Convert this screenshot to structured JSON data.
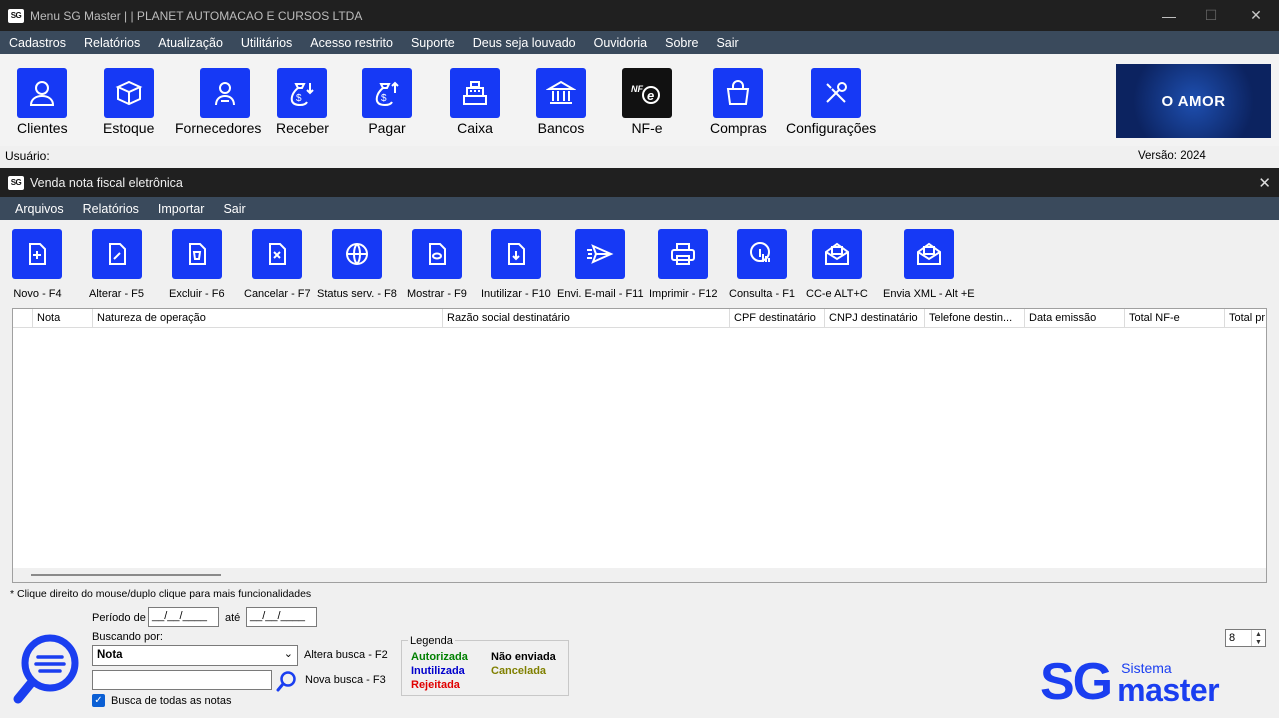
{
  "window": {
    "title": "Menu SG Master | | PLANET AUTOMACAO E CURSOS LTDA",
    "app_badge": "SG",
    "controls": {
      "minimize": "—",
      "maximize": "☐",
      "close": "✕"
    }
  },
  "main_menu": [
    "Cadastros",
    "Relatórios",
    "Atualização",
    "Utilitários",
    "Acesso restrito",
    "Suporte",
    "Deus seja louvado",
    "Ouvidoria",
    "Sobre",
    "Sair"
  ],
  "main_toolbar": [
    {
      "label": "Clientes",
      "icon": "user-icon"
    },
    {
      "label": "Estoque",
      "icon": "box-icon"
    },
    {
      "label": "Fornecedores",
      "icon": "supplier-icon"
    },
    {
      "label": "Receber",
      "icon": "money-bag-down-icon"
    },
    {
      "label": "Pagar",
      "icon": "money-bag-up-icon"
    },
    {
      "label": "Caixa",
      "icon": "cash-register-icon"
    },
    {
      "label": "Bancos",
      "icon": "bank-icon"
    },
    {
      "label": "NF-e",
      "icon": "nfe-icon",
      "badge": "NF e"
    },
    {
      "label": "Compras",
      "icon": "shopping-bag-icon"
    },
    {
      "label": "Configurações",
      "icon": "tools-icon"
    }
  ],
  "banner": {
    "text": "O AMOR"
  },
  "status": {
    "user_label": "Usuário:",
    "version": "Versão: 2024"
  },
  "child_window": {
    "title": "Venda nota fiscal eletrônica",
    "badge": "SG",
    "close": "✕",
    "menu": [
      "Arquivos",
      "Relatórios",
      "Importar",
      "Sair"
    ],
    "toolbar": [
      {
        "label": "Novo - F4",
        "icon": "new-document-icon"
      },
      {
        "label": "Alterar - F5",
        "icon": "edit-document-icon"
      },
      {
        "label": "Excluir - F6",
        "icon": "delete-document-icon"
      },
      {
        "label": "Cancelar - F7",
        "icon": "cancel-document-icon"
      },
      {
        "label": "Status serv. - F8",
        "icon": "globe-sync-icon"
      },
      {
        "label": "Mostrar - F9",
        "icon": "view-document-icon"
      },
      {
        "label": "Inutilizar - F10",
        "icon": "download-document-icon"
      },
      {
        "label": "Envi. E-mail - F11",
        "icon": "send-mail-icon"
      },
      {
        "label": "Imprimir - F12",
        "icon": "printer-icon"
      },
      {
        "label": "Consulta - F1",
        "icon": "touch-query-icon"
      },
      {
        "label": "CC-e ALT+C",
        "icon": "mail-correction-icon"
      },
      {
        "label": "Envia XML - Alt +E",
        "icon": "mail-xml-icon"
      }
    ],
    "grid": {
      "columns": [
        "Nota",
        "Natureza de operação",
        "Razão social destinatário",
        "CPF destinatário",
        "CNPJ destinatário",
        "Telefone destin...",
        "Data emissão",
        "Total NF-e",
        "Total pr"
      ]
    },
    "hint": "* Clique direito do mouse/duplo clique para mais funcionalidades",
    "search": {
      "period_label": "Período de",
      "date_from": "__/__/____",
      "until_label": "até",
      "date_to": "__/__/____",
      "searching_by_label": "Buscando por:",
      "search_by_value": "Nota",
      "alter_search_label": "Altera busca - F2",
      "search_value": "",
      "new_search_label": "Nova busca - F3",
      "all_notes_label": "Busca de todas as notas",
      "all_notes_checked": true
    },
    "legend": {
      "title": "Legenda",
      "items": [
        {
          "label": "Autorizada",
          "color": "#008000"
        },
        {
          "label": "Não enviada",
          "color": "#000000"
        },
        {
          "label": "Inutilizada",
          "color": "#0000cc"
        },
        {
          "label": "Cancelada",
          "color": "#808000"
        },
        {
          "label": "Rejeitada",
          "color": "#e00000"
        }
      ]
    },
    "spinner_value": "8",
    "brand": {
      "big": "SG",
      "small": "Sistema",
      "name": "master"
    }
  }
}
